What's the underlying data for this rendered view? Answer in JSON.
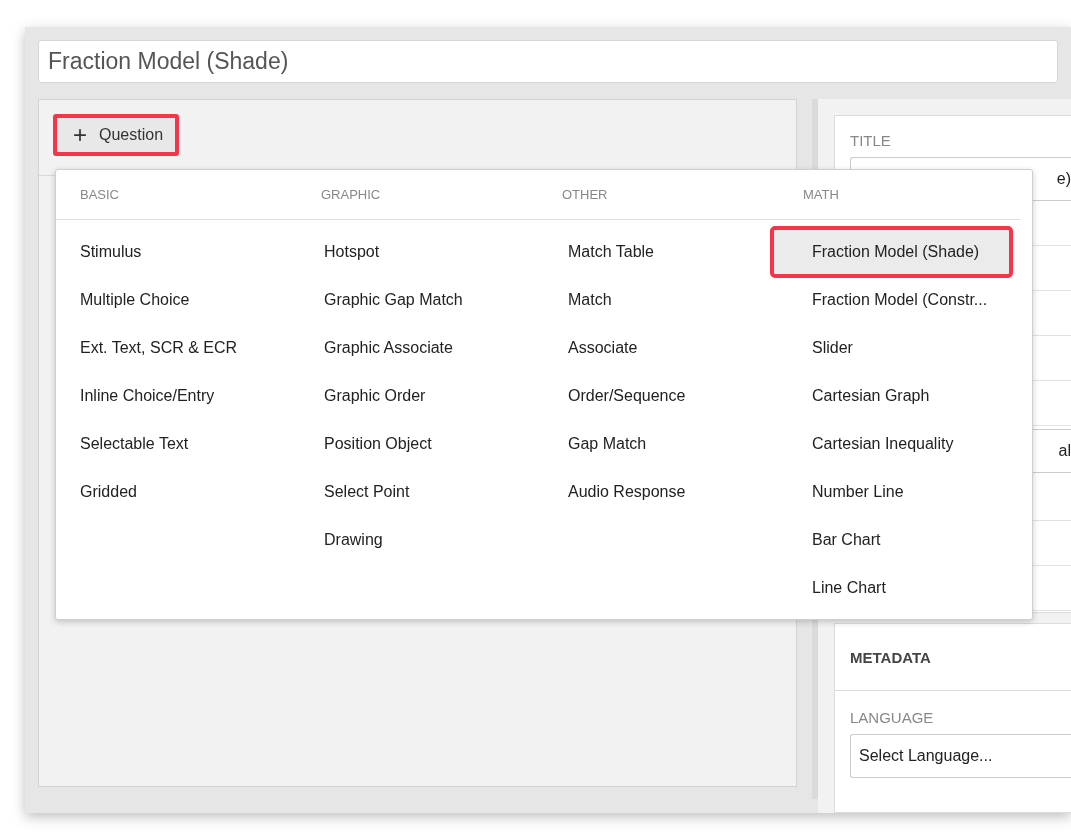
{
  "title_field": {
    "value": "Fraction Model (Shade)"
  },
  "add_question_button": {
    "label": "Question",
    "icon": "+",
    "annotated": true
  },
  "question_menu": {
    "columns": [
      {
        "heading": "BASIC",
        "items": [
          {
            "label": "Stimulus",
            "selected": false,
            "annotated": false
          },
          {
            "label": "Multiple Choice",
            "selected": false,
            "annotated": false
          },
          {
            "label": "Ext. Text, SCR & ECR",
            "selected": false,
            "annotated": false
          },
          {
            "label": "Inline Choice/Entry",
            "selected": false,
            "annotated": false
          },
          {
            "label": "Selectable Text",
            "selected": false,
            "annotated": false
          },
          {
            "label": "Gridded",
            "selected": false,
            "annotated": false
          }
        ]
      },
      {
        "heading": "GRAPHIC",
        "items": [
          {
            "label": "Hotspot",
            "selected": false,
            "annotated": false
          },
          {
            "label": "Graphic Gap Match",
            "selected": false,
            "annotated": false
          },
          {
            "label": "Graphic Associate",
            "selected": false,
            "annotated": false
          },
          {
            "label": "Graphic Order",
            "selected": false,
            "annotated": false
          },
          {
            "label": "Position Object",
            "selected": false,
            "annotated": false
          },
          {
            "label": "Select Point",
            "selected": false,
            "annotated": false
          },
          {
            "label": "Drawing",
            "selected": false,
            "annotated": false
          }
        ]
      },
      {
        "heading": "OTHER",
        "items": [
          {
            "label": "Match Table",
            "selected": false,
            "annotated": false
          },
          {
            "label": "Match",
            "selected": false,
            "annotated": false
          },
          {
            "label": "Associate",
            "selected": false,
            "annotated": false
          },
          {
            "label": "Order/Sequence",
            "selected": false,
            "annotated": false
          },
          {
            "label": "Gap Match",
            "selected": false,
            "annotated": false
          },
          {
            "label": "Audio Response",
            "selected": false,
            "annotated": false
          }
        ]
      },
      {
        "heading": "MATH",
        "items": [
          {
            "label": "Fraction Model (Shade)",
            "selected": true,
            "annotated": true
          },
          {
            "label": "Fraction Model (Constr...",
            "selected": false,
            "annotated": false
          },
          {
            "label": "Slider",
            "selected": false,
            "annotated": false
          },
          {
            "label": "Cartesian Graph",
            "selected": false,
            "annotated": false
          },
          {
            "label": "Cartesian Inequality",
            "selected": false,
            "annotated": false
          },
          {
            "label": "Number Line",
            "selected": false,
            "annotated": false
          },
          {
            "label": "Bar Chart",
            "selected": false,
            "annotated": false
          },
          {
            "label": "Line Chart",
            "selected": false,
            "annotated": false
          }
        ]
      }
    ]
  },
  "settings_panel": {
    "title_label": "TITLE",
    "title_input_fragment": "e)",
    "field_fragment": "al"
  },
  "metadata_panel": {
    "heading": "METADATA",
    "language_label": "LANGUAGE",
    "language_select": {
      "value": "Select Language..."
    }
  }
}
